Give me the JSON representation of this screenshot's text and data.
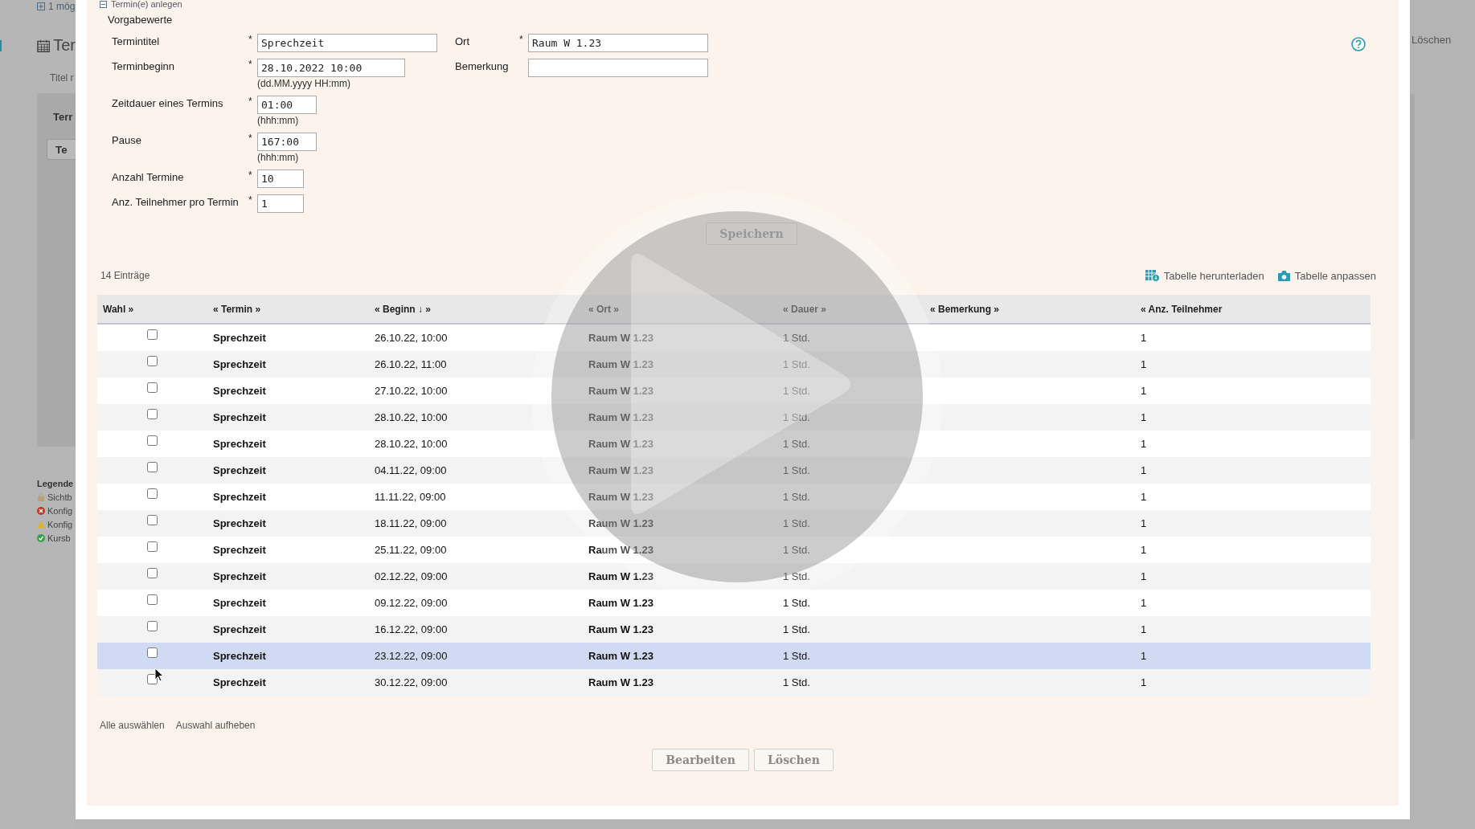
{
  "background_page": {
    "expander": "1 mög",
    "title": "Ter",
    "field_label": "Titel r",
    "panel": {
      "heading": "Terr",
      "button": "Te"
    },
    "legend": {
      "title": "Legende",
      "items": [
        {
          "kind": "lock",
          "text": "Sichtb"
        },
        {
          "kind": "error",
          "text": "Konfig"
        },
        {
          "kind": "warning",
          "text": "Konfig"
        },
        {
          "kind": "ok",
          "text": "Kursb"
        }
      ]
    },
    "right_action": "Löschen"
  },
  "dialog": {
    "section": "Termin(e) anlegen",
    "subtitle": "Vorgabewerte",
    "left_fields": [
      {
        "label": "Termintitel",
        "marker": "*",
        "kind": "text",
        "value": "Sprechzeit"
      },
      {
        "label": "Terminbeginn",
        "marker": "*",
        "kind": "datetime",
        "value": "28.10.2022 10:00",
        "hint": "(dd.MM.yyyy HH:mm)"
      },
      {
        "label": "Zeitdauer eines Termins",
        "marker": "*",
        "kind": "duration",
        "value": "01:00",
        "hint": "(hhh:mm)"
      },
      {
        "label": "Pause",
        "marker": "*",
        "kind": "duration",
        "value": "167:00",
        "hint": "(hhh:mm)"
      },
      {
        "label": "Anzahl Termine",
        "marker": "*",
        "kind": "number",
        "value": "10"
      },
      {
        "label": "Anz. Teilnehmer pro Termin",
        "marker": "*",
        "kind": "number",
        "value": "1"
      }
    ],
    "right_fields": [
      {
        "label": "Ort",
        "marker": "*",
        "kind": "text",
        "value": "Raum W 1.23"
      },
      {
        "label": "Bemerkung",
        "kind": "text"
      }
    ],
    "save_button": {
      "label": "Speichern",
      "disabled": true
    },
    "entry_count": "14 Einträge",
    "table_actions": [
      {
        "kind": "download",
        "label": "Tabelle herunterladen"
      },
      {
        "kind": "settings",
        "label": "Tabelle anpassen"
      }
    ],
    "table": {
      "columns": [
        "Wahl »",
        "« Termin »",
        "« Beginn ↓ »",
        "« Ort »",
        "« Dauer »",
        "« Bemerkung »",
        "« Anz. Teilnehmer"
      ],
      "rows": [
        {
          "checked": false,
          "highlighted": false,
          "termin": "Sprechzeit",
          "beginn": "26.10.22, 10:00",
          "ort": "Raum W 1.23",
          "dauer": "1 Std.",
          "teilnehmer": "1"
        },
        {
          "checked": false,
          "highlighted": false,
          "termin": "Sprechzeit",
          "beginn": "26.10.22, 11:00",
          "ort": "Raum W 1.23",
          "dauer": "1 Std.",
          "teilnehmer": "1"
        },
        {
          "checked": false,
          "highlighted": false,
          "termin": "Sprechzeit",
          "beginn": "27.10.22, 10:00",
          "ort": "Raum W 1.23",
          "dauer": "1 Std.",
          "teilnehmer": "1"
        },
        {
          "checked": false,
          "highlighted": false,
          "termin": "Sprechzeit",
          "beginn": "28.10.22, 10:00",
          "ort": "Raum W 1.23",
          "dauer": "1 Std.",
          "teilnehmer": "1"
        },
        {
          "checked": false,
          "highlighted": false,
          "termin": "Sprechzeit",
          "beginn": "28.10.22, 10:00",
          "ort": "Raum W 1.23",
          "dauer": "1 Std.",
          "teilnehmer": "1"
        },
        {
          "checked": false,
          "highlighted": false,
          "termin": "Sprechzeit",
          "beginn": "04.11.22, 09:00",
          "ort": "Raum W 1.23",
          "dauer": "1 Std.",
          "teilnehmer": "1"
        },
        {
          "checked": false,
          "highlighted": false,
          "termin": "Sprechzeit",
          "beginn": "11.11.22, 09:00",
          "ort": "Raum W 1.23",
          "dauer": "1 Std.",
          "teilnehmer": "1"
        },
        {
          "checked": false,
          "highlighted": false,
          "termin": "Sprechzeit",
          "beginn": "18.11.22, 09:00",
          "ort": "Raum W 1.23",
          "dauer": "1 Std.",
          "teilnehmer": "1"
        },
        {
          "checked": false,
          "highlighted": false,
          "termin": "Sprechzeit",
          "beginn": "25.11.22, 09:00",
          "ort": "Raum W 1.23",
          "dauer": "1 Std.",
          "teilnehmer": "1"
        },
        {
          "checked": false,
          "highlighted": false,
          "termin": "Sprechzeit",
          "beginn": "02.12.22, 09:00",
          "ort": "Raum W 1.23",
          "dauer": "1 Std.",
          "teilnehmer": "1"
        },
        {
          "checked": false,
          "highlighted": false,
          "termin": "Sprechzeit",
          "beginn": "09.12.22, 09:00",
          "ort": "Raum W 1.23",
          "dauer": "1 Std.",
          "teilnehmer": "1"
        },
        {
          "checked": false,
          "highlighted": false,
          "termin": "Sprechzeit",
          "beginn": "16.12.22, 09:00",
          "ort": "Raum W 1.23",
          "dauer": "1 Std.",
          "teilnehmer": "1"
        },
        {
          "checked": false,
          "highlighted": true,
          "termin": "Sprechzeit",
          "beginn": "23.12.22, 09:00",
          "ort": "Raum W 1.23",
          "dauer": "1 Std.",
          "teilnehmer": "1"
        },
        {
          "checked": false,
          "highlighted": false,
          "termin": "Sprechzeit",
          "beginn": "30.12.22, 09:00",
          "ort": "Raum W 1.23",
          "dauer": "1 Std.",
          "teilnehmer": "1"
        }
      ]
    },
    "selection_links": [
      "Alle auswählen",
      "Auswahl aufheben"
    ],
    "buttons": [
      {
        "label": "Bearbeiten",
        "disabled": true
      },
      {
        "label": "Löschen",
        "disabled": true
      }
    ]
  }
}
